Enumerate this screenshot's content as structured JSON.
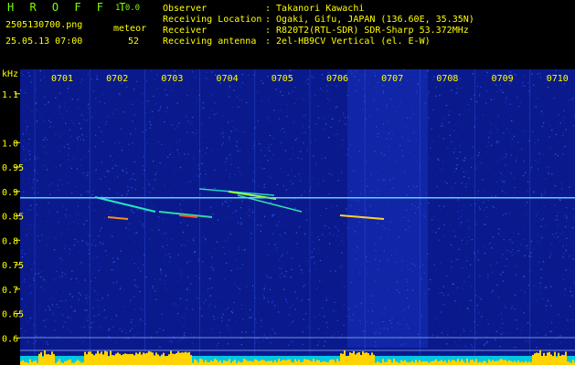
{
  "header": {
    "logo_text": "H R O F F T",
    "version": "1.0.0",
    "filename": "2505130700.png",
    "meteor_label": "meteor",
    "datetime": "25.05.13 07:00",
    "meteor_count": "52",
    "info": [
      {
        "label": "Observer",
        "value": ": Takanori Kawachi"
      },
      {
        "label": "Receiving Location",
        "value": ": Ogaki, Gifu, JAPAN (136.60E, 35.35N)"
      },
      {
        "label": "Receiver",
        "value": ": R820T2(RTL-SDR) SDR-Sharp 53.372MHz"
      },
      {
        "label": "Receiving antenna",
        "value": ": 2el-HB9CV Vertical (el. E-W)"
      }
    ]
  },
  "chart_data": {
    "type": "heatmap",
    "ylabel": "kHz",
    "x_ticks": [
      "0701",
      "0702",
      "0703",
      "0704",
      "0705",
      "0706",
      "0707",
      "0708",
      "0709",
      "0710"
    ],
    "y_ticks": [
      "1.1",
      "1.0",
      "0.95",
      "0.9",
      "0.85",
      "0.8",
      "0.75",
      "0.7",
      "0.65",
      "0.6"
    ],
    "ylim": [
      0.58,
      1.15
    ],
    "carrier_khz": 0.887,
    "colors": {
      "background": "#0a1a8c",
      "grid": "#3a62ff",
      "axis_text": "#ffff00",
      "carrier": "#66ccff",
      "baseline": "#ffd400"
    }
  }
}
